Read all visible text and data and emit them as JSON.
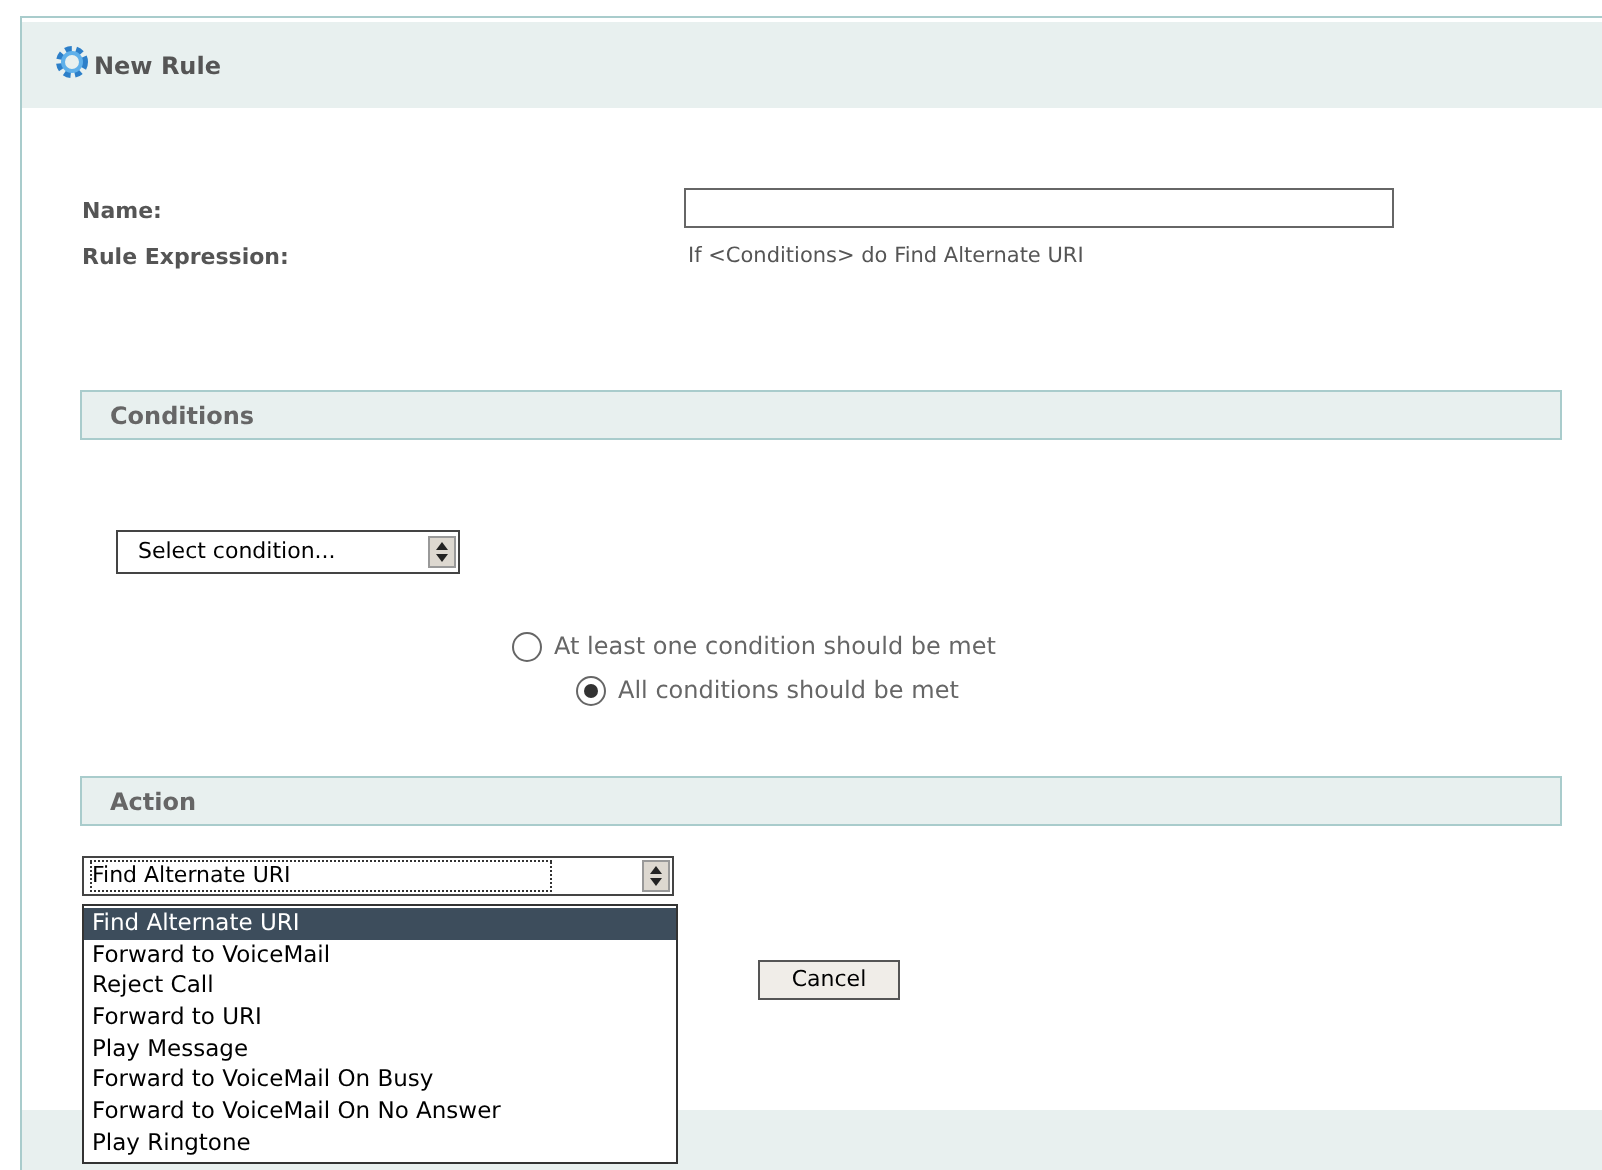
{
  "header": {
    "title": "New Rule"
  },
  "form": {
    "name_label": "Name:",
    "expression_label": "Rule Expression:",
    "expression": "If <Conditions> do Find Alternate URI"
  },
  "conditions": {
    "title": "Conditions",
    "select": "Select condition...",
    "radios": [
      {
        "label": "At least one condition should be met",
        "selected": false
      },
      {
        "label": "All conditions should be met",
        "selected": true
      }
    ]
  },
  "action": {
    "title": "Action",
    "select": "Find Alternate URI",
    "expanded": true,
    "options": [
      {
        "label": "Find Alternate URI",
        "selected": true
      },
      {
        "label": "Forward to VoiceMail",
        "selected": false
      },
      {
        "label": "Reject Call",
        "selected": false
      },
      {
        "label": "Forward to URI",
        "selected": false
      },
      {
        "label": "Play Message",
        "selected": false
      },
      {
        "label": "Forward to VoiceMail On Busy",
        "selected": false
      },
      {
        "label": "Forward to VoiceMail On No Answer",
        "selected": false
      },
      {
        "label": "Play Ringtone",
        "selected": false
      }
    ]
  },
  "buttons": {
    "cancel": "Cancel"
  }
}
